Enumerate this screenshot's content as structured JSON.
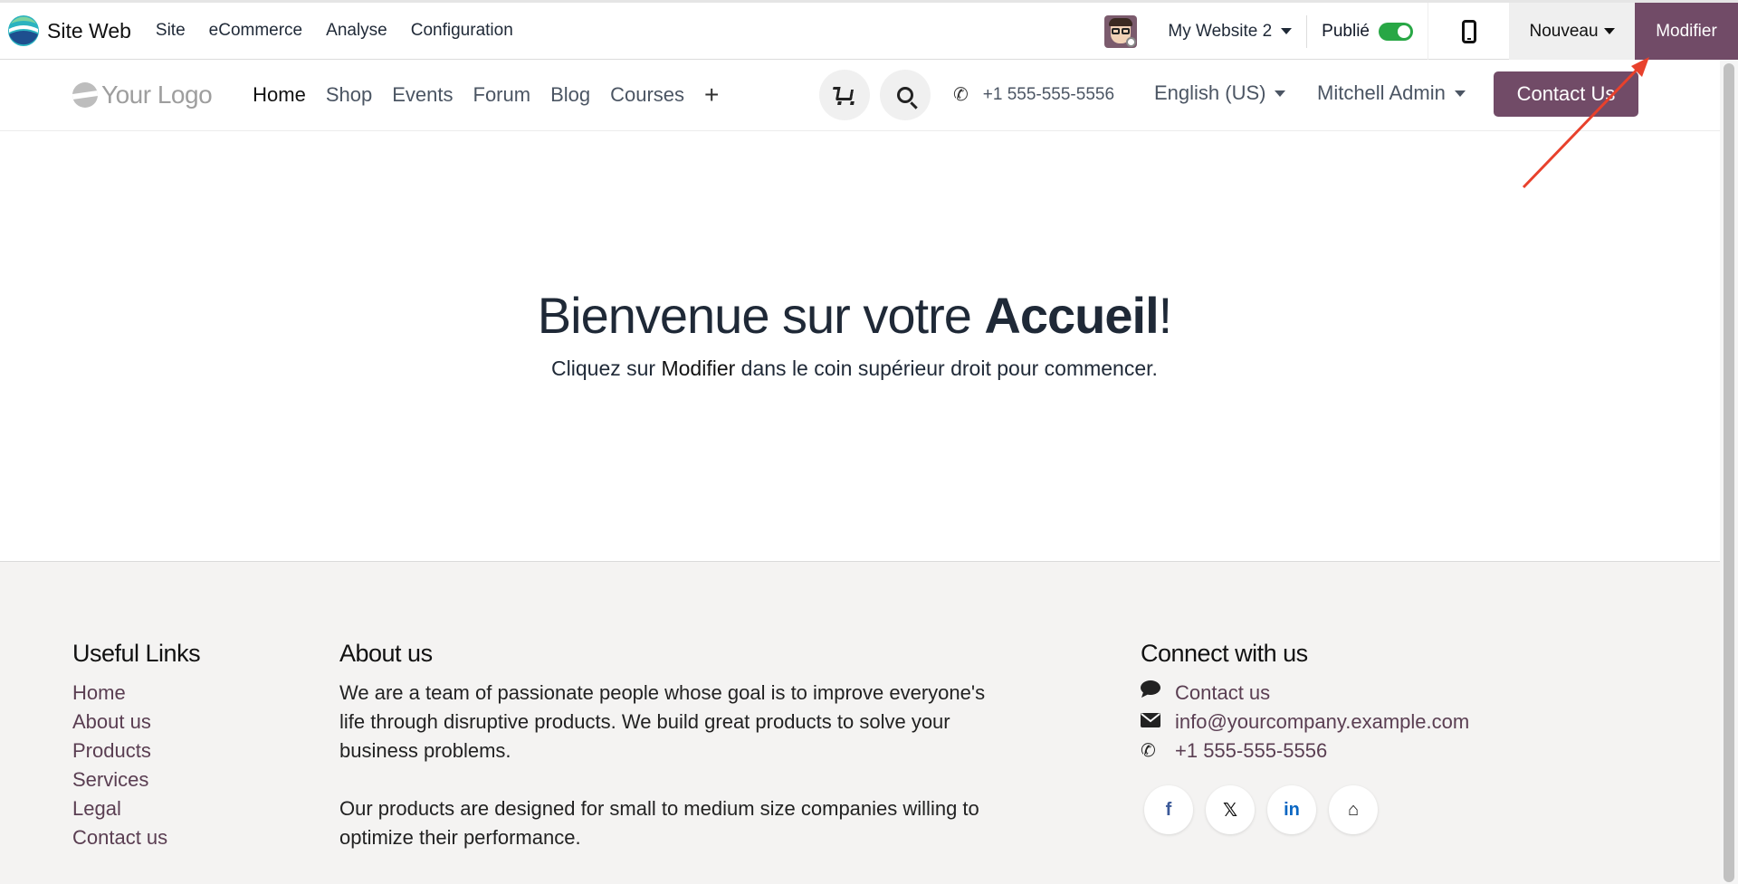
{
  "adminbar": {
    "app_name": "Site Web",
    "menu": [
      "Site",
      "eCommerce",
      "Analyse",
      "Configuration"
    ],
    "website_selector": "My Website 2",
    "published_label": "Publié",
    "published": true,
    "new_button": "Nouveau",
    "edit_button": "Modifier",
    "accent_color": "#714b67"
  },
  "header": {
    "logo_text": "Your Logo",
    "nav": [
      "Home",
      "Shop",
      "Events",
      "Forum",
      "Blog",
      "Courses"
    ],
    "nav_add": "+",
    "phone": "+1 555-555-5556",
    "language": "English (US)",
    "user": "Mitchell Admin",
    "contact_button": "Contact Us"
  },
  "hero": {
    "title_part1": "Bienvenue sur votre ",
    "title_bold": "Accueil",
    "title_end": "!",
    "subtitle_part1": "Cliquez sur ",
    "subtitle_bold": "Modifier",
    "subtitle_part2": " dans le coin supérieur droit pour commencer."
  },
  "footer": {
    "useful_links": {
      "title": "Useful Links",
      "links": [
        "Home",
        "About us",
        "Products",
        "Services",
        "Legal",
        "Contact us"
      ]
    },
    "about": {
      "title": "About us",
      "paragraph1": "We are a team of passionate people whose goal is to improve everyone's life through disruptive products. We build great products to solve your business problems.",
      "paragraph2": "Our products are designed for small to medium size companies willing to optimize their performance."
    },
    "connect": {
      "title": "Connect with us",
      "contact": "Contact us",
      "email": "info@yourcompany.example.com",
      "phone": "+1 555-555-5556",
      "socials": [
        {
          "icon": "facebook-icon",
          "glyph": "f",
          "color": "#3b5998"
        },
        {
          "icon": "x-twitter-icon",
          "glyph": "𝕏",
          "color": "#111111"
        },
        {
          "icon": "linkedin-icon",
          "glyph": "in",
          "color": "#0a66c2"
        },
        {
          "icon": "home-icon",
          "glyph": "⌂",
          "color": "#111111"
        }
      ]
    }
  },
  "annotation": {
    "arrow_color": "#e8412c"
  }
}
